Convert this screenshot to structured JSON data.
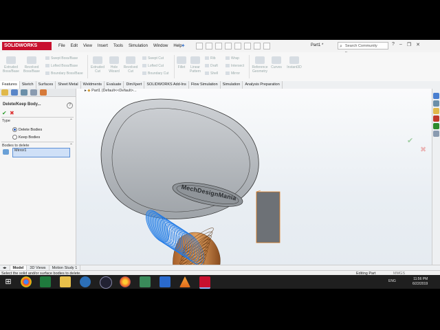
{
  "titlebar": {
    "logo": "SOLIDWORKS",
    "menus": [
      "File",
      "Edit",
      "View",
      "Insert",
      "Tools",
      "Simulation",
      "Window",
      "Help"
    ],
    "document_name": "Part1 *",
    "search_placeholder": "Search Community Forum"
  },
  "ribbon": {
    "features": [
      {
        "label": "Extruded Boss/Base"
      },
      {
        "label": "Revolved Boss/Base"
      },
      {
        "label": "Extruded Cut"
      },
      {
        "label": "Hole Wizard"
      },
      {
        "label": "Revolved Cut"
      },
      {
        "label": "Fillet"
      },
      {
        "label": "Linear Pattern"
      },
      {
        "label": "Reference Geometry"
      },
      {
        "label": "Curves"
      },
      {
        "label": "Instant3D"
      }
    ],
    "small": [
      "Swept Boss/Base",
      "Lofted Boss/Base",
      "Boundary Boss/Base",
      "Swept Cut",
      "Lofted Cut",
      "Boundary Cut",
      "Rib",
      "Draft",
      "Shell",
      "Wrap",
      "Intersect",
      "Mirror"
    ]
  },
  "tabs": [
    "Features",
    "Sketch",
    "Surfaces",
    "Sheet Metal",
    "Weldments",
    "Evaluate",
    "DimXpert",
    "SOLIDWORKS Add-Ins",
    "Flow Simulation",
    "Simulation",
    "Analysis Preparation"
  ],
  "property_manager": {
    "title": "Delete/Keep Body...",
    "type_label": "Type",
    "option_delete": "Delete Bodies",
    "option_keep": "Keep Bodies",
    "bodies_label": "Bodies to delete",
    "selected_body": "Mirror1"
  },
  "viewport": {
    "tree_label": "Part1  (Default<<Default>...",
    "engraved_text": "MechDesignMania"
  },
  "bottom_tabs": [
    "Model",
    "3D Views",
    "Motion Study 1"
  ],
  "status": {
    "message": "Select the solid and/or surface bodies to delete.",
    "mode": "Editing Part",
    "units": "MMGS"
  },
  "taskbar": {
    "language": "ENG",
    "time": "11:56 PM",
    "date": "6/22/2019"
  }
}
